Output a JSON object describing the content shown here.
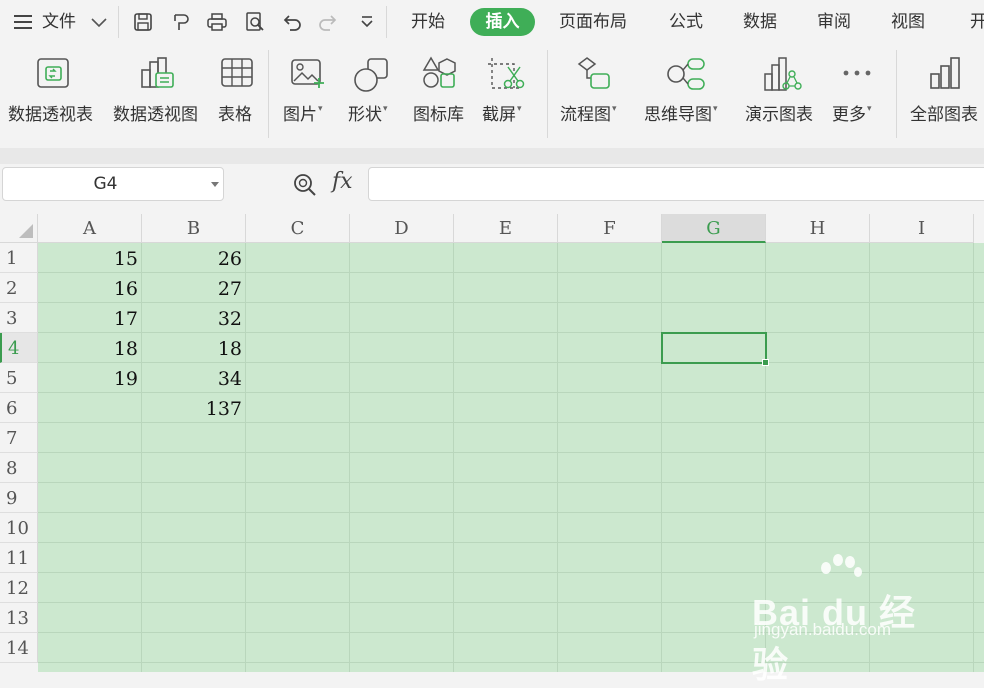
{
  "menu": {
    "file_label": "文件",
    "tabs": [
      "开始",
      "插入",
      "页面布局",
      "公式",
      "数据",
      "审阅",
      "视图",
      "开"
    ],
    "active_tab": "插入"
  },
  "ribbon": {
    "pivot_table": "数据透视表",
    "pivot_chart": "数据透视图",
    "table": "表格",
    "picture": "图片",
    "shape": "形状",
    "icon_library": "图标库",
    "screenshot": "截屏",
    "flowchart": "流程图",
    "mind_map": "思维导图",
    "demo_chart": "演示图表",
    "more": "更多",
    "all_charts": "全部图表"
  },
  "formula_bar": {
    "cell_ref": "G4",
    "fx_label": "fx",
    "formula_value": ""
  },
  "sheet": {
    "columns": [
      "A",
      "B",
      "C",
      "D",
      "E",
      "F",
      "G",
      "H",
      "I"
    ],
    "selected_column": "G",
    "rows": [
      "1",
      "2",
      "3",
      "4",
      "5",
      "6",
      "7",
      "8",
      "9",
      "10",
      "11",
      "12",
      "13",
      "14"
    ],
    "selected_row": "4",
    "col_a": [
      "15",
      "16",
      "17",
      "18",
      "19",
      "",
      "",
      "",
      "",
      "",
      "",
      "",
      "",
      ""
    ],
    "col_b": [
      "26",
      "27",
      "32",
      "18",
      "34",
      "137",
      "",
      "",
      "",
      "",
      "",
      "",
      "",
      ""
    ],
    "selection_color": "#3b9c4f",
    "cell_fill": "#cce8cf"
  },
  "watermark": {
    "brand": "Bai du 经验",
    "url": "jingyan.baidu.com"
  }
}
